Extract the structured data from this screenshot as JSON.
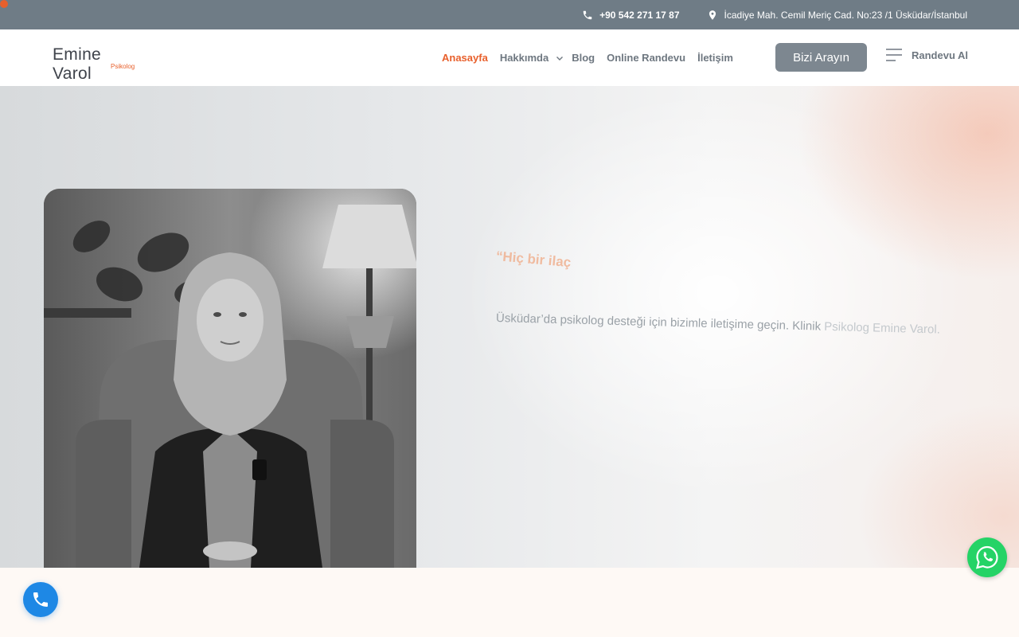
{
  "topbar": {
    "phone": "+90 542 271 17 87",
    "address": "İcadiye Mah. Cemil Meriç Cad. No:23 /1  Üsküdar/İstanbul"
  },
  "header": {
    "logo_name": "Emine Varol",
    "logo_sub": "Psikolog",
    "nav": {
      "home": "Anasayfa",
      "about": "Hakkımda",
      "blog": "Blog",
      "online": "Online Randevu",
      "contact": "İletişim"
    },
    "cta_label": "Bizi Arayın",
    "menu_label": "Randevu Al"
  },
  "hero": {
    "quote": "“Hiç bir ilaç",
    "text_main": "Üsküdar’da psikolog desteği için bizimle iletişime geçin. Klinik",
    "text_fade": " Psikolog Emine Varol."
  },
  "colors": {
    "accent": "#e8602c",
    "topbar": "#6f7c86",
    "cta": "#7d8790",
    "phone_fab": "#1e88e5",
    "whatsapp": "#25d366"
  },
  "icons": [
    "phone-icon",
    "map-pin-icon",
    "chevron-down-icon",
    "hamburger-icon",
    "whatsapp-icon"
  ]
}
